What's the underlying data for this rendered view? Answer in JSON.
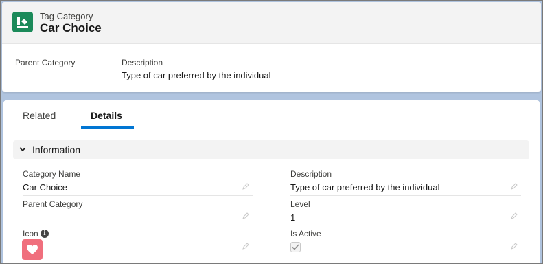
{
  "header": {
    "object_type": "Tag Category",
    "record_title": "Car Choice",
    "icon": "tag-category-icon",
    "icon_color": "#1b8a5a",
    "highlights": [
      {
        "label": "Parent Category",
        "value": ""
      },
      {
        "label": "Description",
        "value": "Type of car preferred by the individual"
      }
    ]
  },
  "tabs": [
    {
      "label": "Related",
      "active": false
    },
    {
      "label": "Details",
      "active": true
    }
  ],
  "accent_color": "#0176d3",
  "section": {
    "title": "Information",
    "expanded": true,
    "fields": {
      "category_name": {
        "label": "Category Name",
        "value": "Car Choice"
      },
      "description": {
        "label": "Description",
        "value": "Type of car preferred by the individual"
      },
      "parent_category": {
        "label": "Parent Category",
        "value": ""
      },
      "level": {
        "label": "Level",
        "value": "1"
      },
      "icon": {
        "label": "Icon",
        "value_icon": "heart-icon",
        "value_color": "#f06f7d",
        "help": "i"
      },
      "is_active": {
        "label": "Is Active",
        "checked": true
      }
    }
  }
}
